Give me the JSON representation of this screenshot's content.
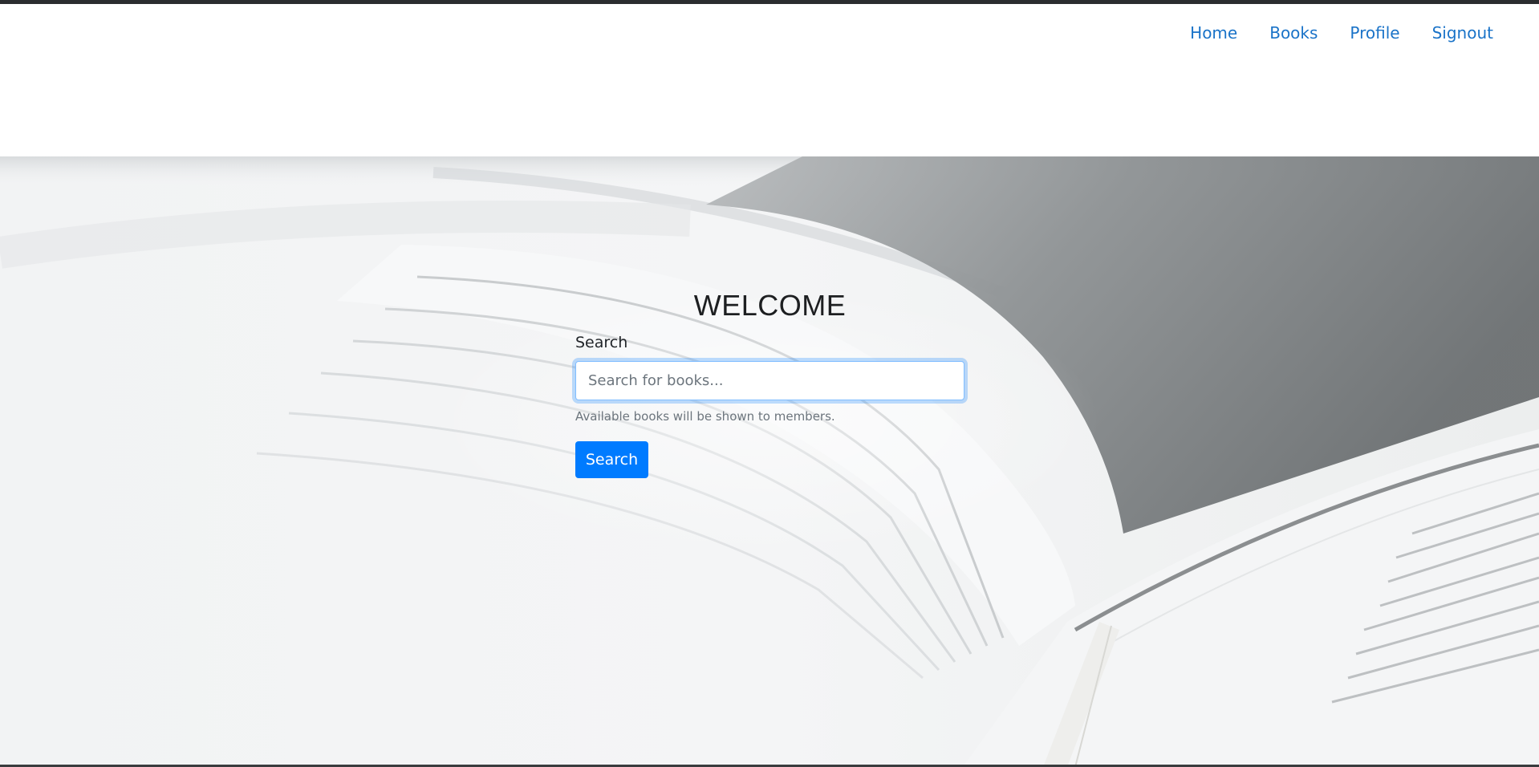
{
  "nav": {
    "items": [
      {
        "label": "Home"
      },
      {
        "label": "Books"
      },
      {
        "label": "Profile"
      },
      {
        "label": "Signout"
      }
    ]
  },
  "hero": {
    "heading": "WELCOME",
    "search_label": "Search",
    "search_placeholder": "Search for books...",
    "search_value": "",
    "help_text": "Available books will be shown to members.",
    "search_button_label": "Search"
  },
  "colors": {
    "link": "#1a73c8",
    "primary_button": "#007bff",
    "top_strip": "#2b2d2f"
  }
}
